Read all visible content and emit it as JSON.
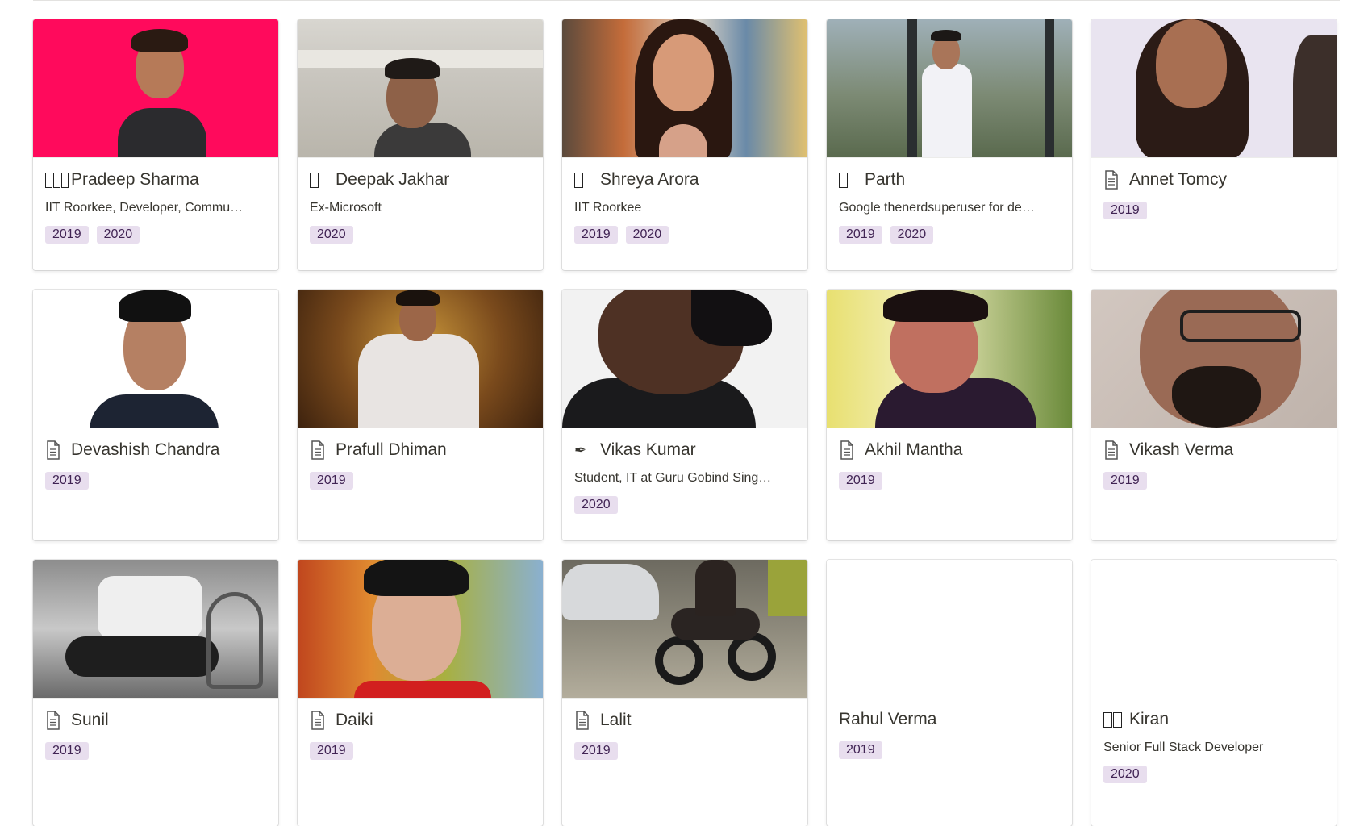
{
  "gallery": {
    "cards": [
      {
        "name": "Pradeep Sharma",
        "icon": "broken-glyph-icon",
        "subtitle": "IIT Roorkee, Developer, Commu…",
        "tags": [
          "2019",
          "2020"
        ]
      },
      {
        "name": "Deepak Jakhar",
        "icon": "broken-glyph-icon",
        "subtitle": "Ex-Microsoft",
        "tags": [
          "2020"
        ]
      },
      {
        "name": "Shreya Arora",
        "icon": "broken-glyph-icon",
        "subtitle": "IIT Roorkee",
        "tags": [
          "2019",
          "2020"
        ]
      },
      {
        "name": "Parth",
        "icon": "broken-glyph-icon",
        "subtitle": "Google thenerdsuperuser for de…",
        "tags": [
          "2019",
          "2020"
        ]
      },
      {
        "name": "Annet Tomcy",
        "icon": "page-icon",
        "subtitle": "",
        "tags": [
          "2019"
        ]
      },
      {
        "name": "Devashish Chandra",
        "icon": "page-icon",
        "subtitle": "",
        "tags": [
          "2019"
        ]
      },
      {
        "name": "Prafull Dhiman",
        "icon": "page-icon",
        "subtitle": "",
        "tags": [
          "2019"
        ]
      },
      {
        "name": "Vikas Kumar",
        "icon": "pen-icon",
        "subtitle": "Student, IT at Guru Gobind Sing…",
        "tags": [
          "2020"
        ]
      },
      {
        "name": "Akhil Mantha",
        "icon": "page-icon",
        "subtitle": "",
        "tags": [
          "2019"
        ]
      },
      {
        "name": "Vikash Verma",
        "icon": "page-icon",
        "subtitle": "",
        "tags": [
          "2019"
        ]
      },
      {
        "name": "Sunil",
        "icon": "page-icon",
        "subtitle": "",
        "tags": [
          "2019"
        ]
      },
      {
        "name": "Daiki",
        "icon": "page-icon",
        "subtitle": "",
        "tags": [
          "2019"
        ]
      },
      {
        "name": "Lalit",
        "icon": "page-icon",
        "subtitle": "",
        "tags": [
          "2019"
        ]
      },
      {
        "name": "Rahul Verma",
        "icon": "none",
        "subtitle": "",
        "tags": [
          "2019"
        ]
      },
      {
        "name": "Kiran",
        "icon": "broken-glyph-icon",
        "subtitle": "Senior Full Stack Developer",
        "tags": [
          "2020"
        ]
      }
    ]
  },
  "colors": {
    "tag_bg": "#e8deee",
    "tag_text": "#412454",
    "text": "#37352f"
  }
}
